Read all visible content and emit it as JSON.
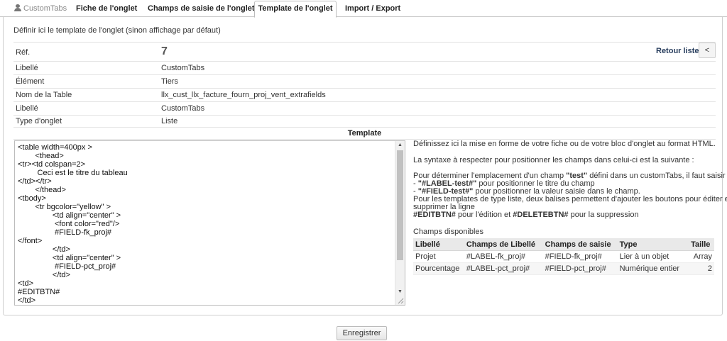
{
  "tabs": {
    "brand": "CustomTabs",
    "items": [
      "Fiche de l'onglet",
      "Champs de saisie de l'onglet",
      "Template de l'onglet",
      "Import / Export"
    ]
  },
  "intro": "Définir ici le template de l'onglet (sinon affichage par défaut)",
  "info": {
    "ref_label": "Réf.",
    "ref_value": "7",
    "retour": "Retour liste",
    "prev": "<",
    "rows": [
      {
        "label": "Libellé",
        "value": "CustomTabs"
      },
      {
        "label": "Élément",
        "value": "Tiers"
      },
      {
        "label": "Nom de la Table",
        "value": "llx_cust_llx_facture_fourn_proj_vent_extrafields"
      },
      {
        "label": "Libellé",
        "value": "CustomTabs"
      },
      {
        "label": "Type d'onglet",
        "value": "Liste"
      }
    ]
  },
  "template_header": "Template",
  "template_code": "<table width=400px >\n        <thead>\n<tr><td colspan=2>\n         Ceci est le titre du tableau\n</td></tr>\n        </thead>\n<tbody>\n        <tr bgcolor=\"yellow\" >\n                <td align=\"center\" >\n                 <font color=\"red\"/>\n                 #FIELD-fk_proj#\n</font>\n                </td>\n                <td align=\"center\" >\n                 #FIELD-pct_proj#\n                </td>\n<td>\n#EDITBTN#\n</td>\n<td>\n#DELETEBTN#",
  "help": {
    "line1": "Définissez ici la mise en forme de votre fiche ou de votre bloc d'onglet au format HTML.",
    "line2": "La syntaxe à respecter pour positionner les champs dans celui-ci est la suivante :",
    "line3a": "Pour déterminer l'emplacement d'un champ ",
    "line3b": "\"test\"",
    "line3c": " défini dans un customTabs, il faut saisir :",
    "line4a": "- ",
    "line4b": "\"#LABEL-test#\"",
    "line4c": " pour positionner le titre du champ",
    "line5a": "- ",
    "line5b": "\"#FIELD-test#\"",
    "line5c": " pour positionner la valeur saisie dans le champ.",
    "line6": "Pour les templates de type liste, deux balises permettent d'ajouter les boutons pour éditer et",
    "line7": "supprimer la ligne",
    "line8a": "#EDITBTN#",
    "line8b": " pour l'édition et ",
    "line8c": "#DELETEBTN#",
    "line8d": " pour la suppression",
    "fields_title": "Champs disponibles"
  },
  "fields": {
    "headers": [
      "Libellé",
      "Champs de Libellé",
      "Champs de saisie",
      "Type",
      "Taille"
    ],
    "rows": [
      [
        "Projet",
        "#LABEL-fk_proj#",
        "#FIELD-fk_proj#",
        "Lier à un objet",
        "Array"
      ],
      [
        "Pourcentage",
        "#LABEL-pct_proj#",
        "#FIELD-pct_proj#",
        "Numérique entier",
        "2"
      ]
    ]
  },
  "save_button": "Enregistrer"
}
